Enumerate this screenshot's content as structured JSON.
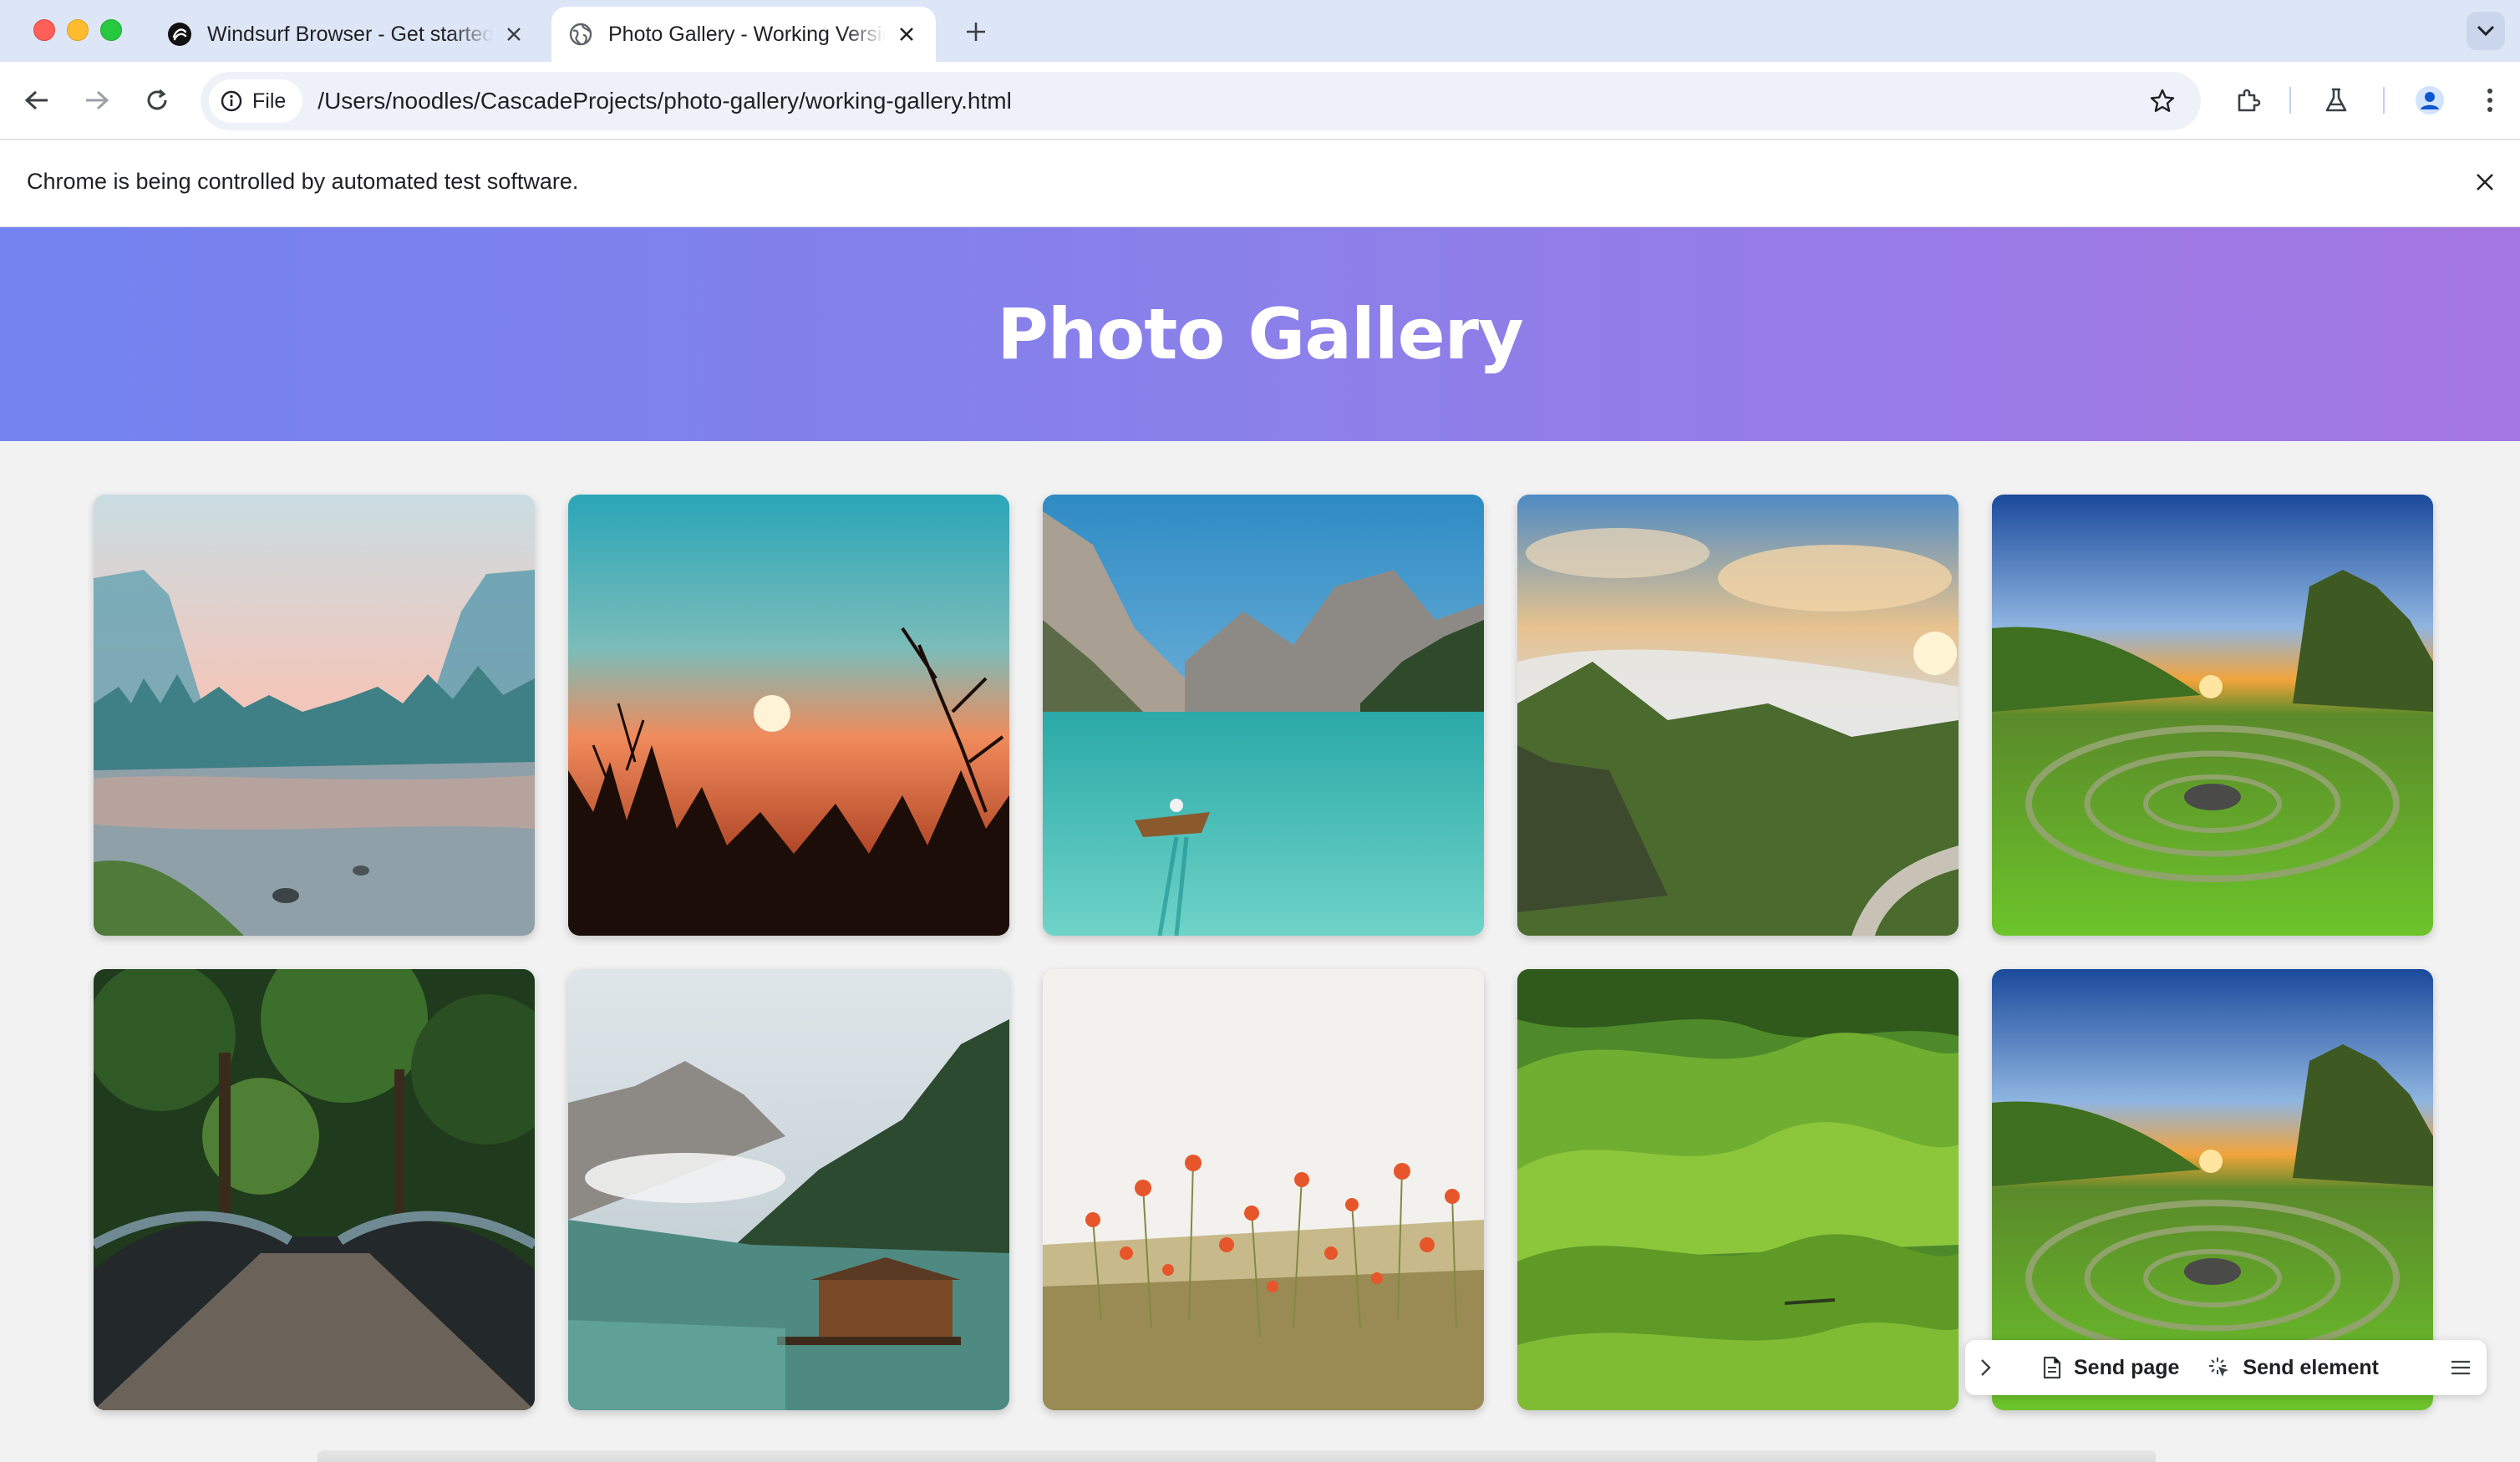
{
  "browser": {
    "tabs": [
      {
        "title": "Windsurf Browser - Get started",
        "favicon": "windsurf-logo-icon",
        "active": false
      },
      {
        "title": "Photo Gallery - Working Version",
        "favicon": "globe-icon",
        "active": true
      }
    ],
    "address": {
      "scheme_chip": "File",
      "url": "/Users/noodles/CascadeProjects/photo-gallery/working-gallery.html"
    },
    "infobar_text": "Chrome is being controlled by automated test software."
  },
  "page": {
    "title": "Photo Gallery",
    "photos": [
      "misty-valley-river",
      "sunset-branches",
      "mountain-lake-boat",
      "cloudy-mountain-cliff",
      "green-stone-circle",
      "forest-bridge",
      "lake-boathouse",
      "poppy-field",
      "green-rolling-hills",
      "green-stone-circle"
    ]
  },
  "devtool_bar": {
    "send_page": "Send page",
    "send_element": "Send element"
  },
  "colors": {
    "header_gradient_start": "#7383f0",
    "header_gradient_end": "#a476e2",
    "tabstrip": "#dde6f7"
  }
}
